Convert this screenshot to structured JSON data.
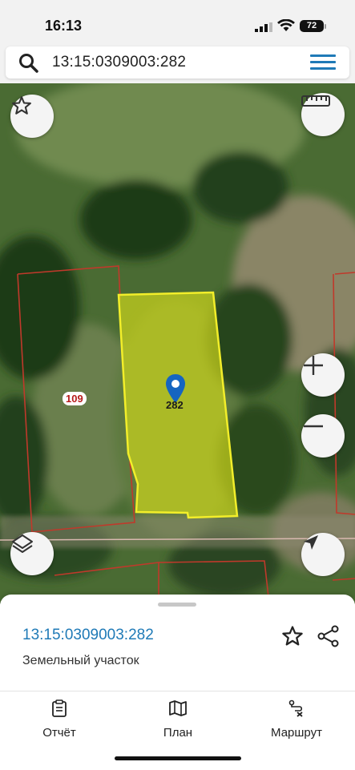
{
  "status_bar": {
    "time": "16:13",
    "battery": "72"
  },
  "search": {
    "query": "13:15:0309003:282"
  },
  "map": {
    "parcel_number": "282",
    "neighbor_label": "109",
    "colors": {
      "selected_fill": "#c9d21c",
      "selected_stroke": "#f2ee2a",
      "boundary": "#c0392b"
    }
  },
  "sheet": {
    "cadastral_number": "13:15:0309003:282",
    "object_type": "Земельный участок"
  },
  "tabs": [
    {
      "label": "Отчёт",
      "icon": "report-icon"
    },
    {
      "label": "План",
      "icon": "map-plan-icon"
    },
    {
      "label": "Маршрут",
      "icon": "route-icon"
    }
  ]
}
